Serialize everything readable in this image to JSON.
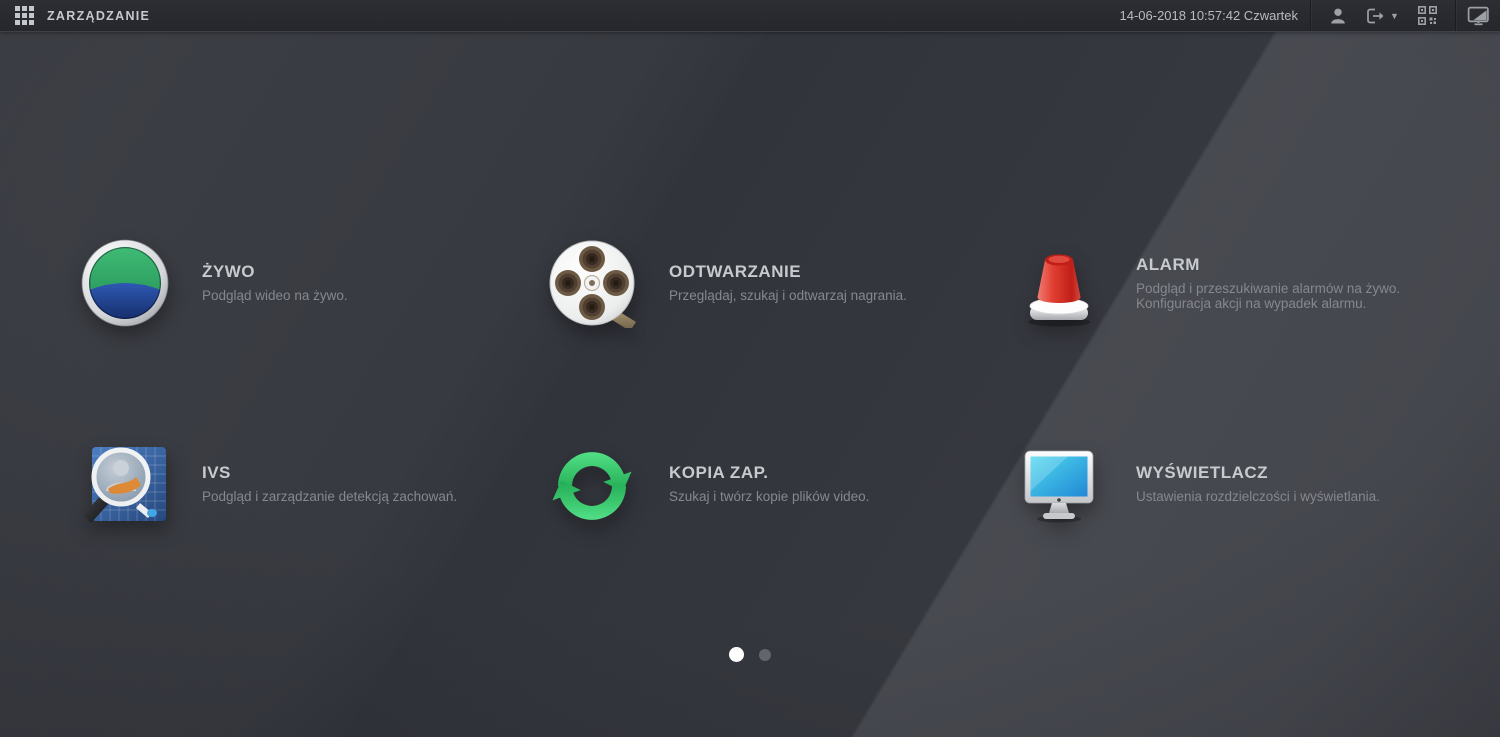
{
  "topbar": {
    "title": "ZARZĄDZANIE",
    "datetime": "14-06-2018 10:57:42 Czwartek",
    "icons": [
      "apps-grid-icon",
      "user-icon",
      "logout-icon",
      "qr-code-icon",
      "display-toggle-icon"
    ]
  },
  "menu": {
    "items": [
      {
        "id": "live",
        "icon": "live-view-icon",
        "title": "ŻYWO",
        "desc": [
          "Podgląd wideo na żywo."
        ]
      },
      {
        "id": "playback",
        "icon": "playback-icon",
        "title": "ODTWARZANIE",
        "desc": [
          "Przeglądaj, szukaj i odtwarzaj nagrania."
        ]
      },
      {
        "id": "alarm",
        "icon": "alarm-icon",
        "title": "ALARM",
        "desc": [
          "Podgląd i przeszukiwanie alarmów na żywo.",
          "Konfiguracja akcji na wypadek alarmu."
        ]
      },
      {
        "id": "ivs",
        "icon": "ivs-icon",
        "title": "IVS",
        "desc": [
          "Podgląd i zarządzanie detekcją zachowań."
        ]
      },
      {
        "id": "backup",
        "icon": "backup-icon",
        "title": "KOPIA ZAP.",
        "desc": [
          "Szukaj i twórz kopie plików video."
        ]
      },
      {
        "id": "display",
        "icon": "display-icon",
        "title": "WYŚWIETLACZ",
        "desc": [
          "Ustawienia rozdzielczości i wyświetlania."
        ]
      }
    ]
  },
  "pagination": {
    "page_count": 2,
    "active_page": 1
  },
  "colors": {
    "topbar_bg": "#282a30",
    "background": "#34363c",
    "live_green": "#2fae63",
    "live_blue": "#1b3f8f",
    "alarm_red": "#d8261d",
    "backup_green": "#27b558",
    "display_cyan": "#35c1e9",
    "ivs_blue": "#35619f",
    "active_dot": "#ffffff",
    "inactive_dot": "#63656b"
  }
}
